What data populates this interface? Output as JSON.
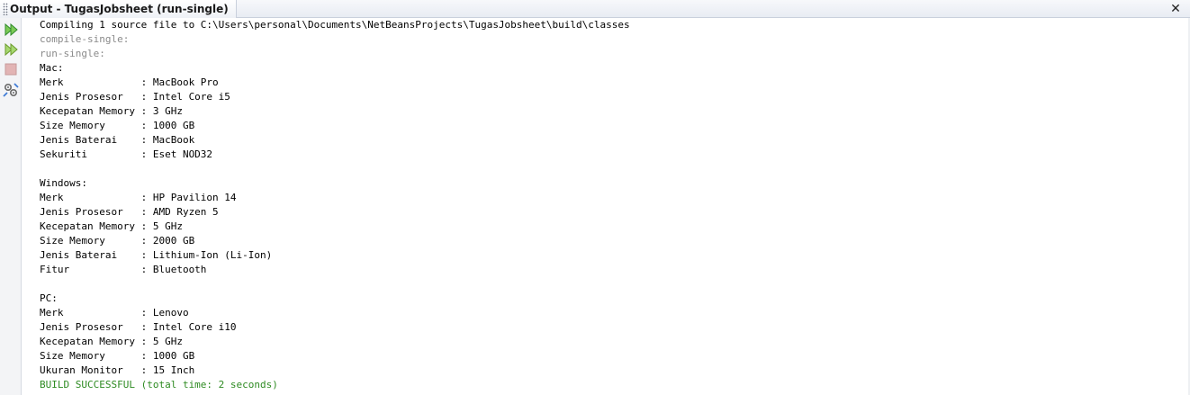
{
  "panel": {
    "title": "Output - TugasJobsheet (run-single)",
    "close_glyph": "✕"
  },
  "toolbar": {
    "buttons": [
      {
        "name": "rerun-icon",
        "enabled": true
      },
      {
        "name": "rerun-with-params-icon",
        "enabled": true
      },
      {
        "name": "stop-icon",
        "enabled": false
      },
      {
        "name": "settings-icon",
        "enabled": true
      }
    ]
  },
  "console": {
    "lines": [
      {
        "text": "Compiling 1 source file to C:\\Users\\personal\\Documents\\NetBeansProjects\\TugasJobsheet\\build\\classes",
        "style": "normal"
      },
      {
        "text": "compile-single:",
        "style": "muted"
      },
      {
        "text": "run-single:",
        "style": "muted"
      },
      {
        "text": "Mac:",
        "style": "normal"
      },
      {
        "text": "Merk             : MacBook Pro",
        "style": "normal"
      },
      {
        "text": "Jenis Prosesor   : Intel Core i5",
        "style": "normal"
      },
      {
        "text": "Kecepatan Memory : 3 GHz",
        "style": "normal"
      },
      {
        "text": "Size Memory      : 1000 GB",
        "style": "normal"
      },
      {
        "text": "Jenis Baterai    : MacBook",
        "style": "normal"
      },
      {
        "text": "Sekuriti         : Eset NOD32",
        "style": "normal"
      },
      {
        "text": "",
        "style": "normal"
      },
      {
        "text": "Windows:",
        "style": "normal"
      },
      {
        "text": "Merk             : HP Pavilion 14",
        "style": "normal"
      },
      {
        "text": "Jenis Prosesor   : AMD Ryzen 5",
        "style": "normal"
      },
      {
        "text": "Kecepatan Memory : 5 GHz",
        "style": "normal"
      },
      {
        "text": "Size Memory      : 2000 GB",
        "style": "normal"
      },
      {
        "text": "Jenis Baterai    : Lithium-Ion (Li-Ion)",
        "style": "normal"
      },
      {
        "text": "Fitur            : Bluetooth",
        "style": "normal"
      },
      {
        "text": "",
        "style": "normal"
      },
      {
        "text": "PC:",
        "style": "normal"
      },
      {
        "text": "Merk             : Lenovo",
        "style": "normal"
      },
      {
        "text": "Jenis Prosesor   : Intel Core i10",
        "style": "normal"
      },
      {
        "text": "Kecepatan Memory : 5 GHz",
        "style": "normal"
      },
      {
        "text": "Size Memory      : 1000 GB",
        "style": "normal"
      },
      {
        "text": "Ukuran Monitor   : 15 Inch",
        "style": "normal"
      },
      {
        "text": "BUILD SUCCESSFUL (total time: 2 seconds)",
        "style": "success"
      }
    ]
  },
  "colors": {
    "success": "#2e8b22",
    "muted": "#8a8a8a",
    "run_icon": "#3fa535"
  }
}
